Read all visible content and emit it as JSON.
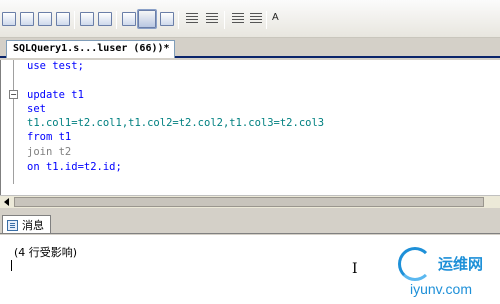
{
  "toolbar": {
    "font_button_text": "A"
  },
  "document_tab": {
    "label": "SQLQuery1.s...luser (66))*"
  },
  "editor": {
    "lines": [
      {
        "text": "use test;",
        "color": "kw"
      },
      {
        "text": "",
        "color": "tx"
      },
      {
        "text": "update t1",
        "color": "kw"
      },
      {
        "text": "set",
        "color": "kw"
      },
      {
        "text": "t1.col1=t2.col1,t1.col2=t2.col2,t1.col3=t2.col3",
        "color": "tx"
      },
      {
        "text": "from t1",
        "color": "kw"
      },
      {
        "text": "join t2",
        "color": "gr"
      },
      {
        "text": "on t1.id=t2.id;",
        "color": "kw"
      }
    ]
  },
  "results": {
    "tab_label": "消息",
    "message": "(4 行受影响)"
  },
  "watermark": {
    "brand": "运维网",
    "url": "iyunv.com"
  },
  "colors": {
    "keyword": "#0000ff",
    "text": "#008080",
    "muted": "#808080",
    "accent": "#1e90d8"
  }
}
